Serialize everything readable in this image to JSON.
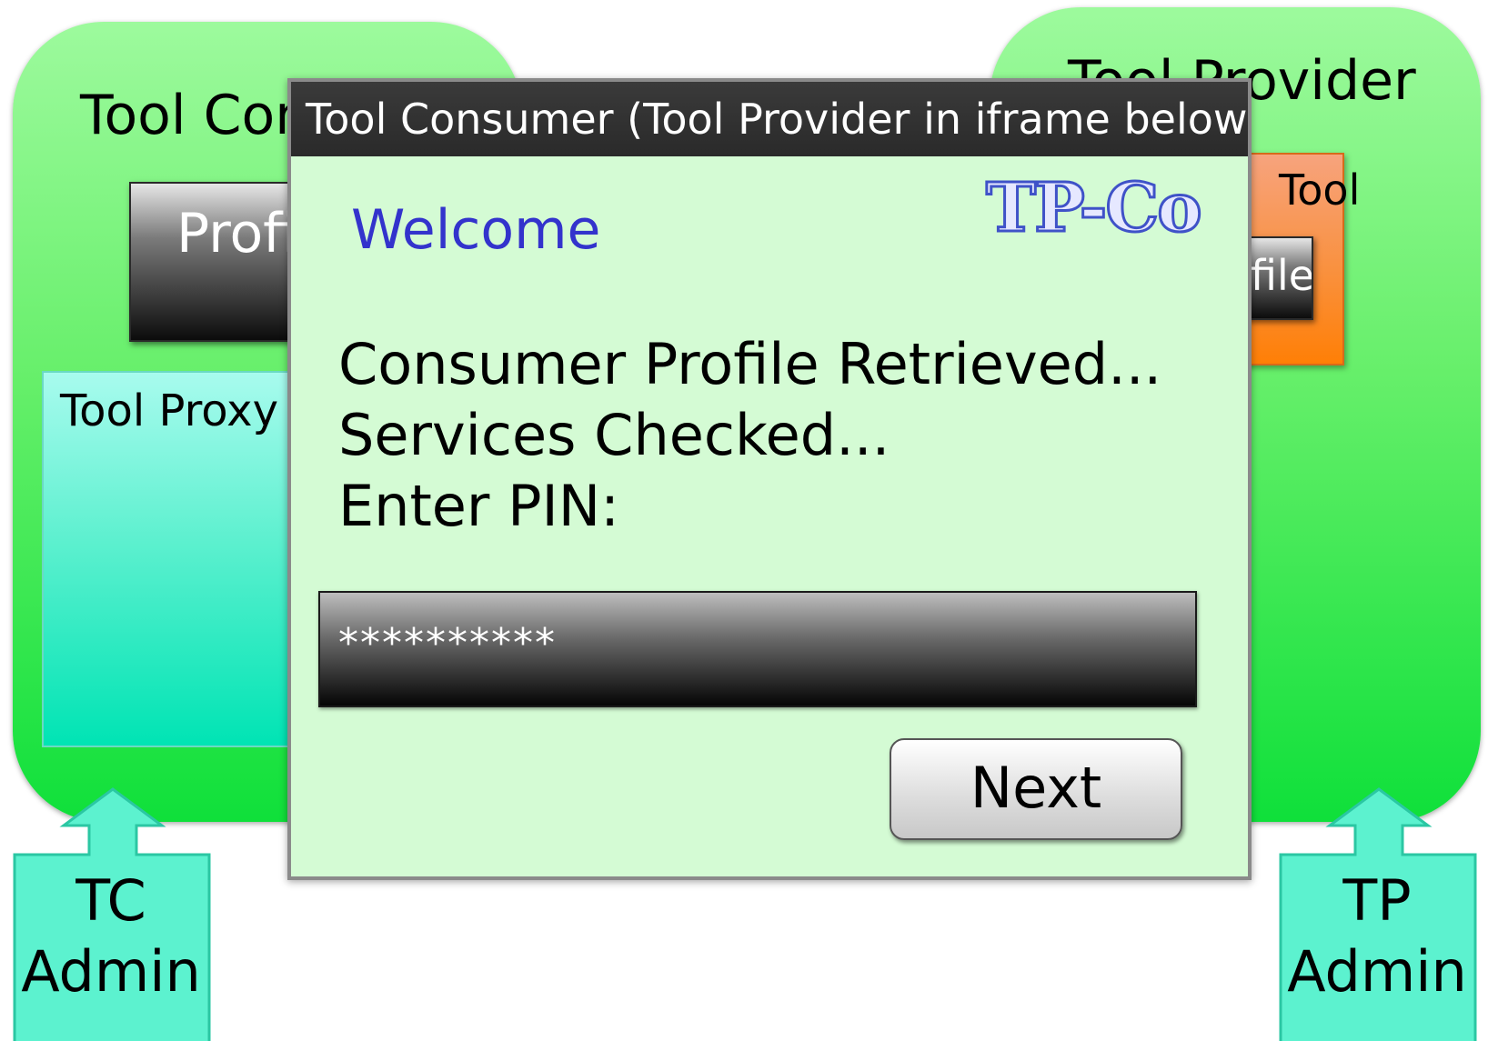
{
  "tool_consumer_box": {
    "title": "Tool Consumer",
    "profile_button": "Profile",
    "tool_proxy_label": "Tool Proxy"
  },
  "tool_provider_box": {
    "title": "Tool Provider",
    "tool_label": "Tool",
    "profile_button": "Profile"
  },
  "admins": {
    "tc": [
      "TC",
      "Admin"
    ],
    "tp": [
      "TP",
      "Admin"
    ]
  },
  "dialog": {
    "title": "Tool Consumer (Tool Provider in iframe below)",
    "welcome": "Welcome",
    "logo_text": "TP-Co",
    "status_lines": [
      "Consumer Profile Retrieved...",
      "Services Checked...",
      "Enter PIN:"
    ],
    "pin_value": "**********",
    "next_label": "Next"
  },
  "colors": {
    "green_box": "#66ef6a",
    "dialog_bg": "#d4fbd4",
    "welcome_text": "#3333cc",
    "tool_proxy": "#5df0cf",
    "tool_orange": "#f9913f",
    "admin_teal": "#5cf2cf"
  }
}
